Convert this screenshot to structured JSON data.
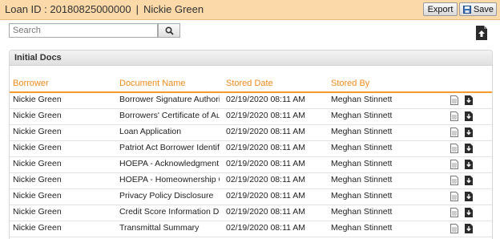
{
  "header": {
    "loan_label": "Loan ID : 20180825000000",
    "separator": "|",
    "borrower_name": "Nickie Green",
    "export_label": "Export",
    "save_label": "Save"
  },
  "search": {
    "placeholder": "Search",
    "value": ""
  },
  "panel": {
    "title": "Initial Docs",
    "columns": [
      "Borrower",
      "Document Name",
      "Stored Date",
      "Stored By"
    ],
    "rows": [
      {
        "borrower": "Nickie Green",
        "document": "Borrower Signature Authoriza…",
        "date": "02/19/2020 08:11 AM",
        "by": "Meghan Stinnett"
      },
      {
        "borrower": "Nickie Green",
        "document": "Borrowers' Certificate of Auth…",
        "date": "02/19/2020 08:11 AM",
        "by": "Meghan Stinnett"
      },
      {
        "borrower": "Nickie Green",
        "document": "Loan Application",
        "date": "02/19/2020 08:11 AM",
        "by": "Meghan Stinnett"
      },
      {
        "borrower": "Nickie Green",
        "document": "Patriot Act Borrower Identific…",
        "date": "02/19/2020 08:11 AM",
        "by": "Meghan Stinnett"
      },
      {
        "borrower": "Nickie Green",
        "document": "HOEPA - Acknowledgment of…",
        "date": "02/19/2020 08:11 AM",
        "by": "Meghan Stinnett"
      },
      {
        "borrower": "Nickie Green",
        "document": "HOEPA - Homeownership Co…",
        "date": "02/19/2020 08:11 AM",
        "by": "Meghan Stinnett"
      },
      {
        "borrower": "Nickie Green",
        "document": "Privacy Policy Disclosure",
        "date": "02/19/2020 08:11 AM",
        "by": "Meghan Stinnett"
      },
      {
        "borrower": "Nickie Green",
        "document": "Credit Score Information Disc…",
        "date": "02/19/2020 08:11 AM",
        "by": "Meghan Stinnett"
      },
      {
        "borrower": "Nickie Green",
        "document": "Transmittal Summary",
        "date": "02/19/2020 08:11 AM",
        "by": "Meghan Stinnett"
      }
    ]
  },
  "icons": {
    "save": "save-icon",
    "search": "search-icon",
    "upload": "upload-icon",
    "view": "document-icon",
    "download": "download-icon"
  },
  "colors": {
    "header_bg": "#fbd9a8",
    "accent": "#f08a1c"
  }
}
